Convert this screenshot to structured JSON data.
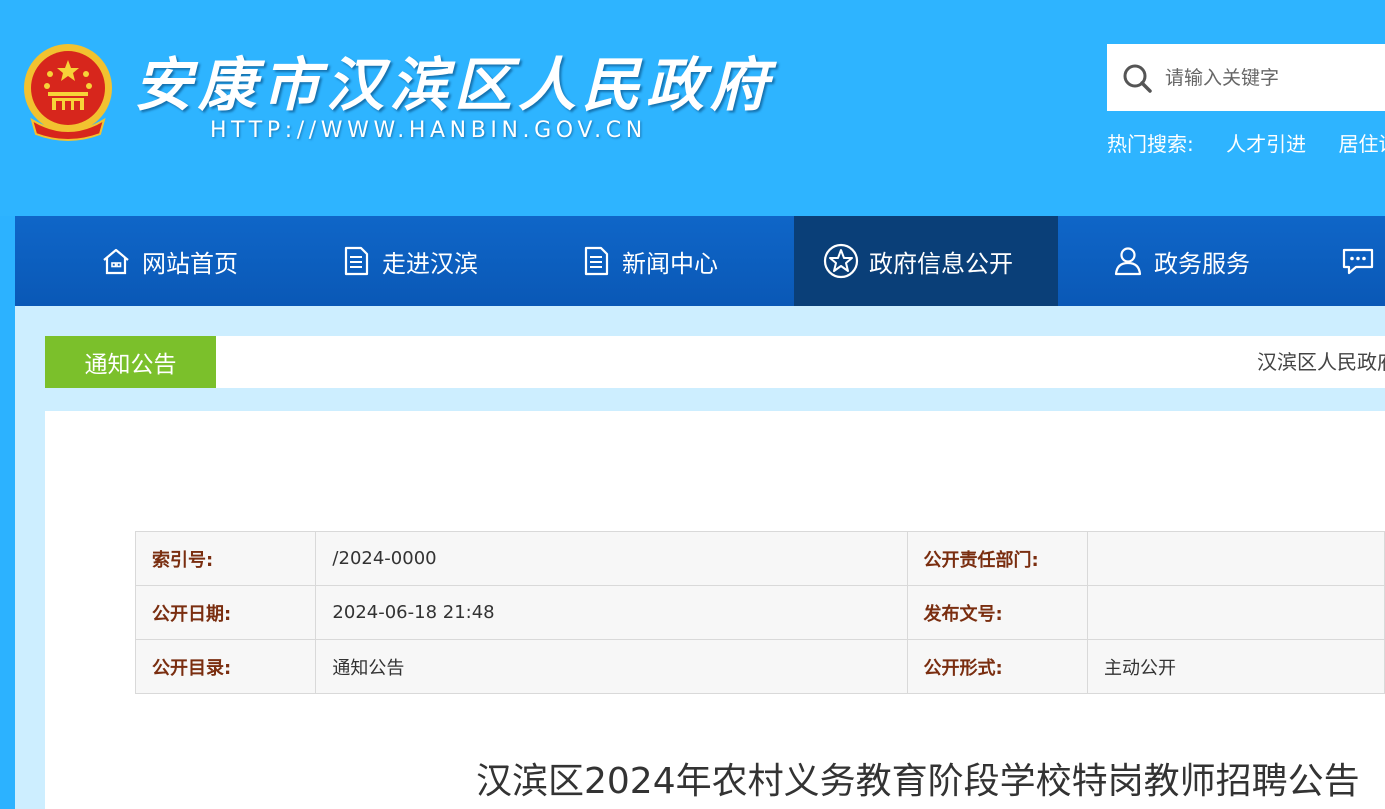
{
  "header": {
    "site_title": "安康市汉滨区人民政府",
    "site_url": "HTTP://WWW.HANBIN.GOV.CN",
    "search": {
      "placeholder": "请输入关键字"
    },
    "hot_search": {
      "label": "热门搜索:",
      "items": [
        "人才引进",
        "居住证"
      ]
    }
  },
  "nav": {
    "items": [
      {
        "label": "网站首页",
        "icon": "home-icon"
      },
      {
        "label": "走进汉滨",
        "icon": "document-icon"
      },
      {
        "label": "新闻中心",
        "icon": "document-icon"
      },
      {
        "label": "政府信息公开",
        "icon": "star-icon",
        "active": true
      },
      {
        "label": "政务服务",
        "icon": "user-icon"
      },
      {
        "label": "",
        "icon": "chat-icon"
      }
    ]
  },
  "notice": {
    "tab_label": "通知公告",
    "breadcrumb": "汉滨区人民政府"
  },
  "meta_table": {
    "rows": [
      {
        "k1": "索引号:",
        "v1": "/2024-0000",
        "k2": "公开责任部门:",
        "v2": ""
      },
      {
        "k1": "公开日期:",
        "v1": "2024-06-18 21:48",
        "k2": "发布文号:",
        "v2": ""
      },
      {
        "k1": "公开目录:",
        "v1": "通知公告",
        "k2": "公开形式:",
        "v2": "主动公开"
      }
    ]
  },
  "article": {
    "title": "汉滨区2024年农村义务教育阶段学校特岗教师招聘公告"
  },
  "colors": {
    "header_bg": "#2eb4ff",
    "nav_bg": "#0a58b6",
    "nav_active": "#0a3f78",
    "tab_green": "#7bc02b",
    "content_bg": "#cdeeff"
  }
}
